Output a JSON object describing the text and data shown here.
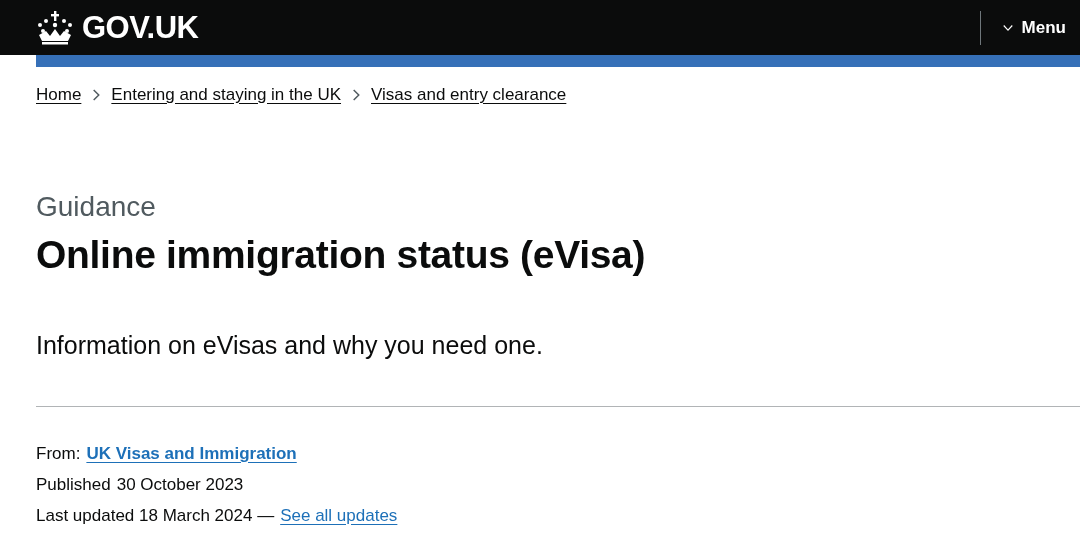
{
  "header": {
    "logo": "GOV.UK",
    "menu": "Menu"
  },
  "breadcrumbs": [
    {
      "label": "Home"
    },
    {
      "label": "Entering and staying in the UK"
    },
    {
      "label": "Visas and entry clearance"
    }
  ],
  "caption": "Guidance",
  "title": "Online immigration status (eVisa)",
  "lead": "Information on eVisas and why you need one.",
  "metadata": {
    "from_label": "From:",
    "from_link": "UK Visas and Immigration",
    "published_label": "Published",
    "published_date": "30 October 2023",
    "updated": "Last updated 18 March 2024 —",
    "updates_link": "See all updates"
  }
}
